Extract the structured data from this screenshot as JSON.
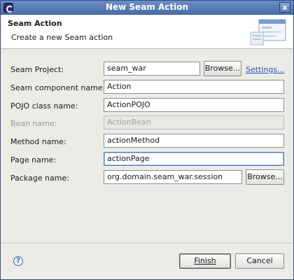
{
  "window": {
    "title": "New Seam Action",
    "close_label": "x"
  },
  "header": {
    "title": "Seam Action",
    "description": "Create a new Seam action"
  },
  "form": {
    "seam_project": {
      "label": "Seam Project:",
      "value": "seam_war",
      "browse_label": "Browse...",
      "settings_label": "Settings..."
    },
    "component_name": {
      "label": "Seam component name:",
      "value": "Action"
    },
    "pojo_class": {
      "label": "POJO class name:",
      "value": "ActionPOJO"
    },
    "bean_name": {
      "label": "Bean name:",
      "value": "ActionBean",
      "disabled": true
    },
    "method_name": {
      "label": "Method name:",
      "value": "actionMethod"
    },
    "page_name": {
      "label": "Page name:",
      "value": "actionPage",
      "focused": true
    },
    "package_name": {
      "label": "Package name:",
      "value": "org.domain.seam_war.session",
      "browse_label": "Browse..."
    }
  },
  "footer": {
    "help_icon": "?",
    "finish_label": "Finish",
    "cancel_label": "Cancel"
  }
}
